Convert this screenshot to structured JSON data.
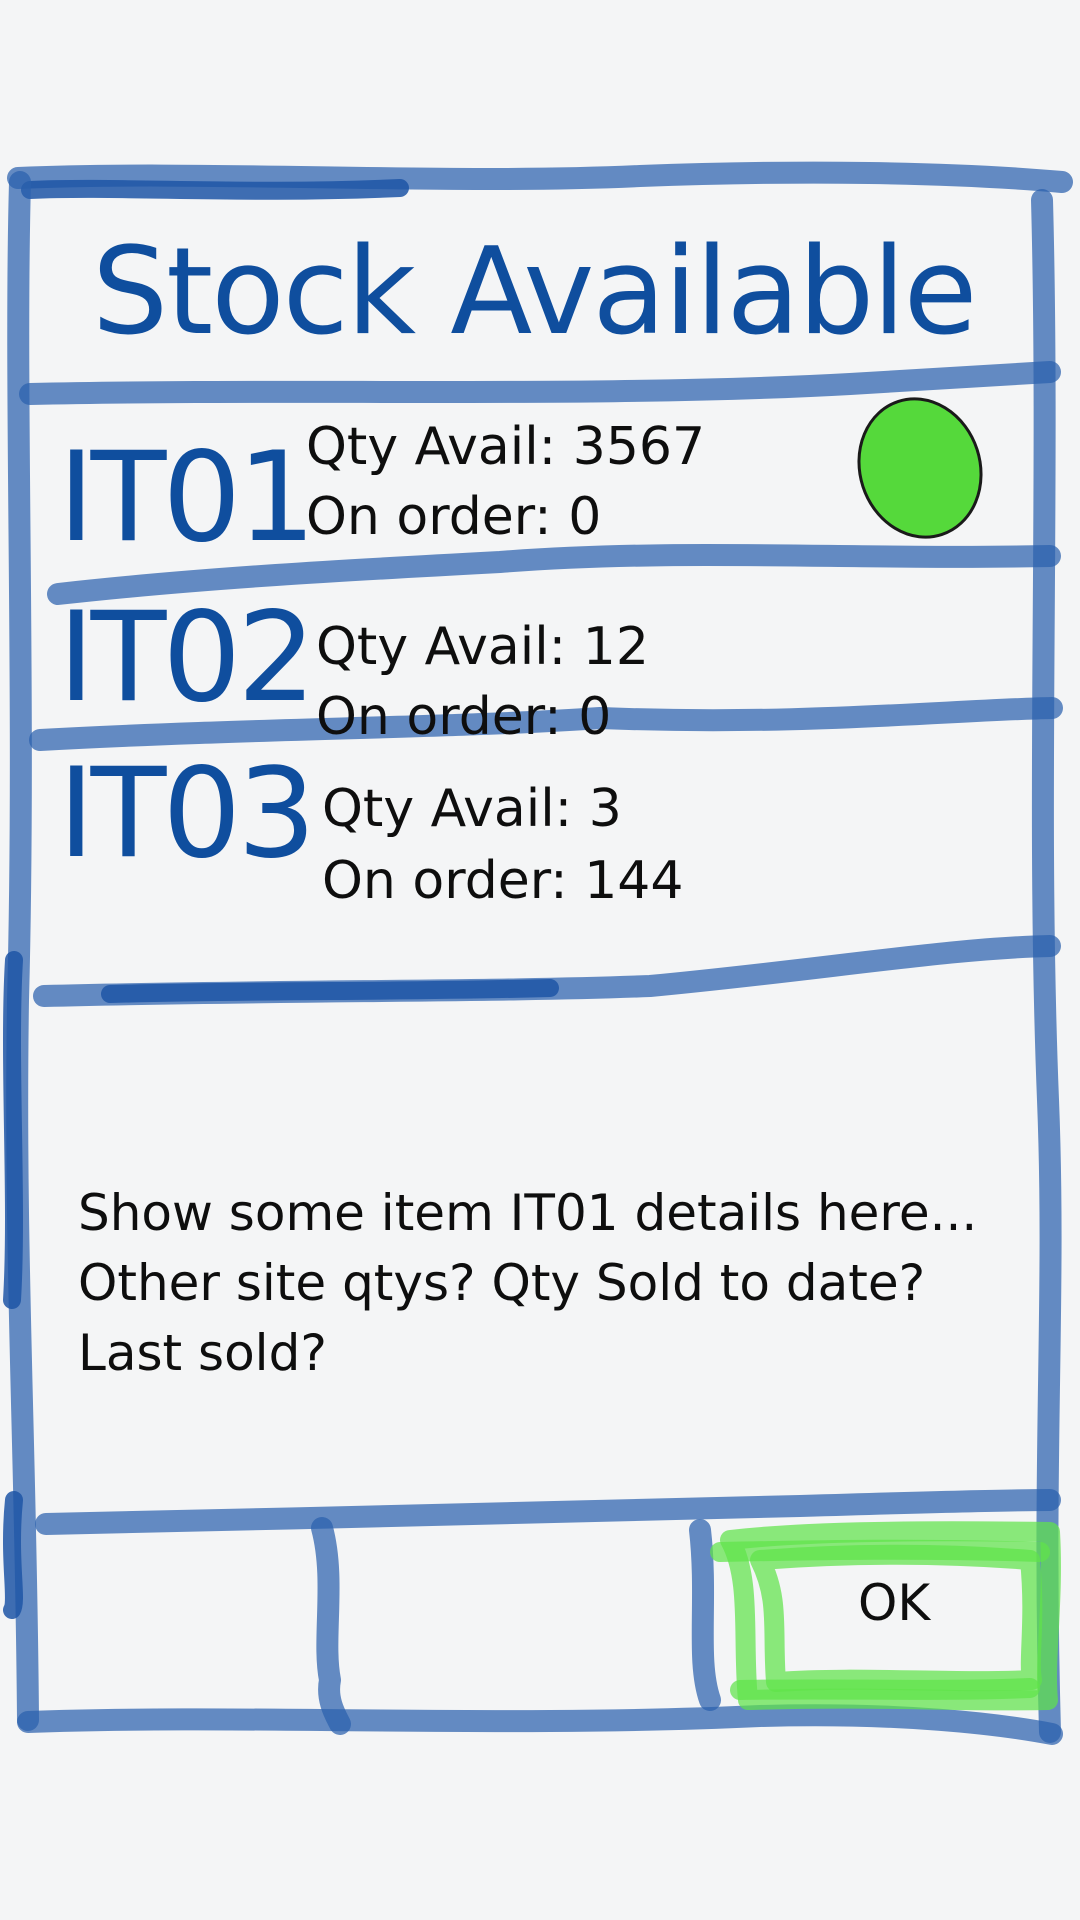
{
  "dialog": {
    "title": "Stock Available"
  },
  "items": [
    {
      "code": "IT01",
      "qty_avail": "Qty Avail: 3567",
      "on_order": "On order: 0",
      "status_color": "#55d93b"
    },
    {
      "code": "IT02",
      "qty_avail": "Qty Avail: 12",
      "on_order": "On order: 0"
    },
    {
      "code": "IT03",
      "qty_avail": "Qty Avail: 3",
      "on_order": "On order: 144"
    }
  ],
  "details": {
    "text": "Show some item IT01 details here... Other site qtys? Qty Sold to date? Last sold?"
  },
  "actions": {
    "ok_label": "OK"
  },
  "colors": {
    "sketch_blue": "#2b61ad",
    "title_blue": "#0f4e9e",
    "ok_highlight": "#5fe34a",
    "background": "#f4f5f6"
  }
}
